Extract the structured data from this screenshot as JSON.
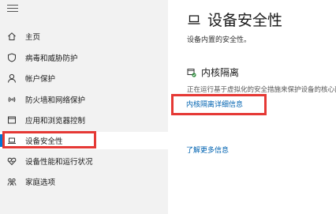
{
  "sidebar": {
    "items": [
      {
        "label": "主页",
        "icon": "home-icon"
      },
      {
        "label": "病毒和威胁防护",
        "icon": "shield-icon"
      },
      {
        "label": "帐户保护",
        "icon": "person-icon"
      },
      {
        "label": "防火墙和网络保护",
        "icon": "wifi-icon"
      },
      {
        "label": "应用和浏览器控制",
        "icon": "app-window-icon"
      },
      {
        "label": "设备安全性",
        "icon": "laptop-icon"
      },
      {
        "label": "设备性能和运行状况",
        "icon": "heart-icon"
      },
      {
        "label": "家庭选项",
        "icon": "family-icon"
      }
    ],
    "active_index": 5
  },
  "main": {
    "title": "设备安全性",
    "title_icon": "laptop-icon",
    "subtitle": "设备内置的安全性。",
    "section": {
      "title": "内核隔离",
      "icon": "core-isolation-icon",
      "description": "正在运行基于虚拟化的安全措施来保护设备的核心部分。",
      "link": "内核隔离详细信息"
    },
    "more_link": "了解更多信息"
  },
  "colors": {
    "sidebar_bg": "#f2f2f2",
    "accent": "#0078d7",
    "link": "#0063b1",
    "highlight": "#e53935"
  }
}
